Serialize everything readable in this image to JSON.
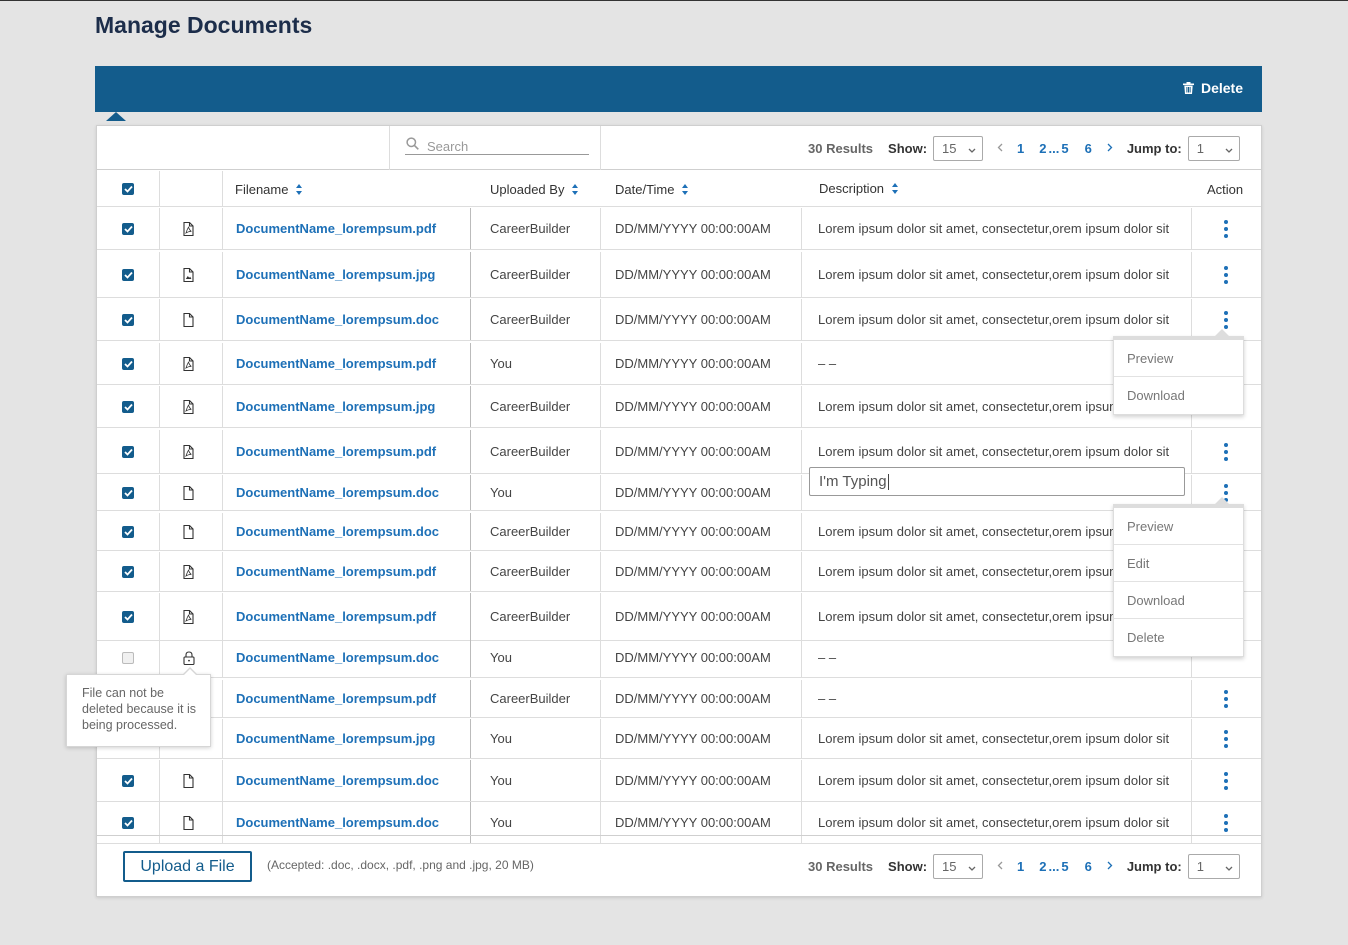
{
  "page_title": "Manage Documents",
  "bulk_bar": {
    "delete_label": "Delete"
  },
  "search": {
    "placeholder": "Search"
  },
  "pager": {
    "results": "30 Results",
    "show_label": "Show:",
    "show_value": "15",
    "pages": [
      "1",
      "2",
      "...",
      "5",
      "6"
    ],
    "jump_label": "Jump to:",
    "jump_value": "1"
  },
  "columns": {
    "filename": "Filename",
    "uploaded_by": "Uploaded By",
    "datetime": "Date/Time",
    "description": "Description",
    "action": "Action"
  },
  "rows": [
    {
      "checked": true,
      "icon": "pdf-icon",
      "filename": "DocumentName_lorempsum.pdf",
      "uploaded_by": "CareerBuilder",
      "datetime": "DD/MM/YYYY 00:00:00AM",
      "description": "Lorem ipsum dolor sit amet, consectetur,orem ipsum dolor sit"
    },
    {
      "checked": true,
      "icon": "image-icon",
      "filename": "DocumentName_lorempsum.jpg",
      "uploaded_by": "CareerBuilder",
      "datetime": "DD/MM/YYYY 00:00:00AM",
      "description": "Lorem ipsum dolor sit amet, consectetur,orem ipsum dolor sit"
    },
    {
      "checked": true,
      "icon": "doc-icon",
      "filename": "DocumentName_lorempsum.doc",
      "uploaded_by": "CareerBuilder",
      "datetime": "DD/MM/YYYY 00:00:00AM",
      "description": "Lorem ipsum dolor sit amet, consectetur,orem ipsum dolor sit"
    },
    {
      "checked": true,
      "icon": "pdf-icon",
      "filename": "DocumentName_lorempsum.pdf",
      "uploaded_by": "You",
      "datetime": "DD/MM/YYYY 00:00:00AM",
      "description": "– –"
    },
    {
      "checked": true,
      "icon": "pdf-icon",
      "filename": "DocumentName_lorempsum.jpg",
      "uploaded_by": "CareerBuilder",
      "datetime": "DD/MM/YYYY 00:00:00AM",
      "description": "Lorem ipsum dolor sit amet, consectetur,orem ipsum"
    },
    {
      "checked": true,
      "icon": "pdf-icon",
      "filename": "DocumentName_lorempsum.pdf",
      "uploaded_by": "CareerBuilder",
      "datetime": "DD/MM/YYYY 00:00:00AM",
      "description": "Lorem ipsum dolor sit amet, consectetur,orem ipsum dolor sit"
    },
    {
      "checked": true,
      "icon": "doc-icon",
      "filename": "DocumentName_lorempsum.doc",
      "uploaded_by": "You",
      "datetime": "DD/MM/YYYY 00:00:00AM",
      "description": ""
    },
    {
      "checked": true,
      "icon": "doc-icon",
      "filename": "DocumentName_lorempsum.doc",
      "uploaded_by": "CareerBuilder",
      "datetime": "DD/MM/YYYY 00:00:00AM",
      "description": "Lorem ipsum dolor sit amet, consectetur,orem ipsum"
    },
    {
      "checked": true,
      "icon": "pdf-icon",
      "filename": "DocumentName_lorempsum.pdf",
      "uploaded_by": "CareerBuilder",
      "datetime": "DD/MM/YYYY 00:00:00AM",
      "description": "Lorem ipsum dolor sit amet, consectetur,orem ipsum"
    },
    {
      "checked": true,
      "icon": "pdf-icon",
      "filename": "DocumentName_lorempsum.pdf",
      "uploaded_by": "CareerBuilder",
      "datetime": "DD/MM/YYYY 00:00:00AM",
      "description": "Lorem ipsum dolor sit amet, consectetur,orem ipsum"
    },
    {
      "checked": false,
      "icon": "lock-icon",
      "filename": "DocumentName_lorempsum.doc",
      "uploaded_by": "You",
      "datetime": "DD/MM/YYYY 00:00:00AM",
      "description": "– –"
    },
    {
      "checked": true,
      "icon": "pdf-icon",
      "filename": "DocumentName_lorempsum.pdf",
      "uploaded_by": "CareerBuilder",
      "datetime": "DD/MM/YYYY 00:00:00AM",
      "description": "– –"
    },
    {
      "checked": true,
      "icon": "image-icon",
      "filename": "DocumentName_lorempsum.jpg",
      "uploaded_by": "You",
      "datetime": "DD/MM/YYYY 00:00:00AM",
      "description": "Lorem ipsum dolor sit amet, consectetur,orem ipsum dolor sit"
    },
    {
      "checked": true,
      "icon": "doc-icon",
      "filename": "DocumentName_lorempsum.doc",
      "uploaded_by": "You",
      "datetime": "DD/MM/YYYY 00:00:00AM",
      "description": "Lorem ipsum dolor sit amet, consectetur,orem ipsum dolor sit"
    },
    {
      "checked": true,
      "icon": "doc-icon",
      "filename": "DocumentName_lorempsum.doc",
      "uploaded_by": "You",
      "datetime": "DD/MM/YYYY 00:00:00AM",
      "description": "Lorem ipsum dolor sit amet, consectetur,orem ipsum dolor sit"
    }
  ],
  "menu_small": [
    "Preview",
    "Download"
  ],
  "menu_large": [
    "Preview",
    "Edit",
    "Download",
    "Delete"
  ],
  "typing_value": "I'm Typing",
  "tooltip": "File can not be deleted because it is being processed.",
  "footer": {
    "upload_label": "Upload a File",
    "accepted": "(Accepted: .doc, .docx, .pdf, .png and .jpg, 20 MB)"
  },
  "colors": {
    "primary": "#135c8c",
    "link": "#1d70b7",
    "title": "#1c2d4a"
  }
}
